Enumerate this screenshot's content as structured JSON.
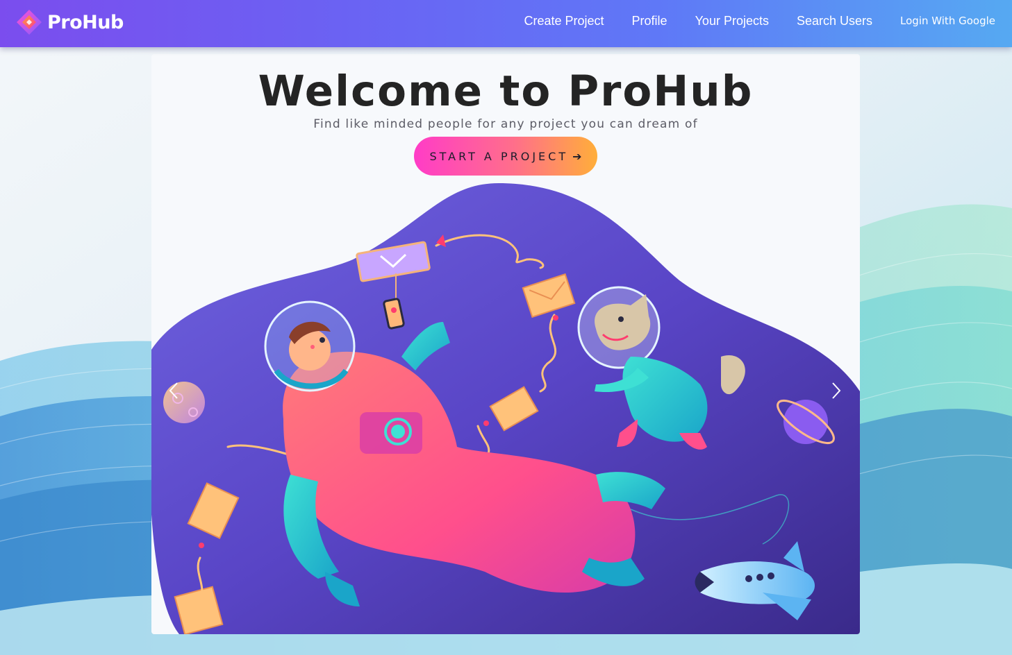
{
  "brand": {
    "name": "ProHub",
    "logo_icon": "diamond-logo-icon"
  },
  "nav": {
    "links": [
      "Create Project",
      "Profile",
      "Your Projects",
      "Search Users"
    ],
    "login": "Login With Google"
  },
  "hero": {
    "title": "Welcome to ProHub",
    "subtitle": "Find like minded people for any project you can dream of",
    "cta_label": "START A PROJECT",
    "cta_icon": "arrow-right-icon",
    "illustration": "astronaut-and-dog-floating-in-space-with-envelopes"
  },
  "carousel": {
    "prev_icon": "chevron-left-icon",
    "next_icon": "chevron-right-icon"
  },
  "colors": {
    "nav_start": "#7b4dee",
    "nav_end": "#56a9f2",
    "cta_start": "#ff3cc7",
    "cta_end": "#ffae3a",
    "blob": "#5d4fcf",
    "title": "#242424"
  }
}
